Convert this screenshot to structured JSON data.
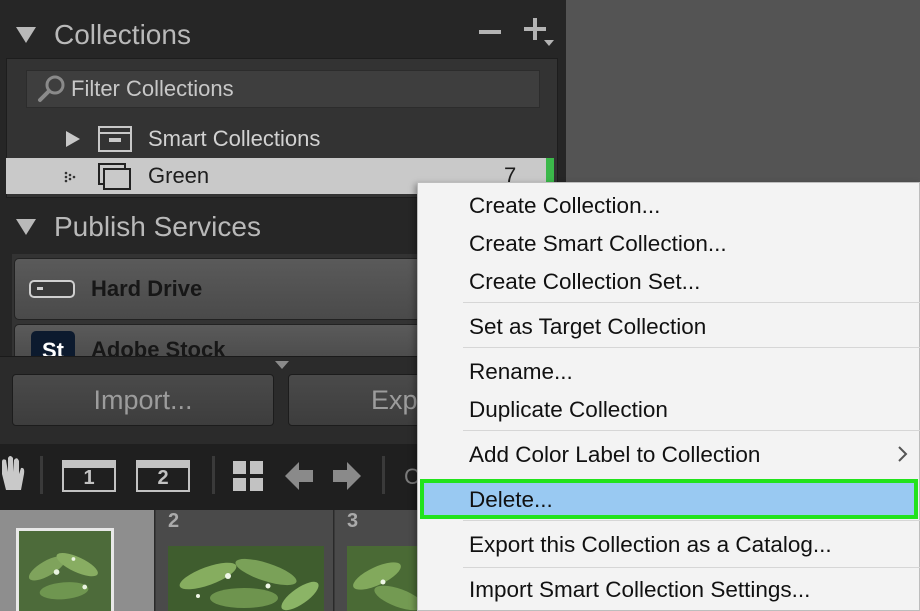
{
  "collections": {
    "title": "Collections",
    "filter_placeholder": "Filter Collections",
    "items": [
      {
        "name": "Smart Collections",
        "count": ""
      },
      {
        "name": "Green",
        "count": "7"
      }
    ]
  },
  "publish": {
    "title": "Publish Services",
    "services": [
      {
        "name": "Hard Drive"
      },
      {
        "name": "Adobe Stock",
        "badge": "St"
      }
    ]
  },
  "buttons": {
    "import": "Import...",
    "export": "Export..."
  },
  "toolbar": {
    "view1": "1",
    "view2": "2",
    "trailing": "C"
  },
  "filmstrip": {
    "numbers": [
      "2",
      "3"
    ]
  },
  "context_menu": {
    "items": [
      "Create Collection...",
      "Create Smart Collection...",
      "Create Collection Set...",
      "Set as Target Collection",
      "Rename...",
      "Duplicate Collection",
      "Add Color Label to Collection",
      "Delete...",
      "Export this Collection as a Catalog...",
      "Import Smart Collection Settings..."
    ],
    "highlighted": "Delete..."
  },
  "colors": {
    "selection_accent": "#3bb84a",
    "menu_highlight": "#99c9f2",
    "highlight_outline": "#22e31c"
  }
}
